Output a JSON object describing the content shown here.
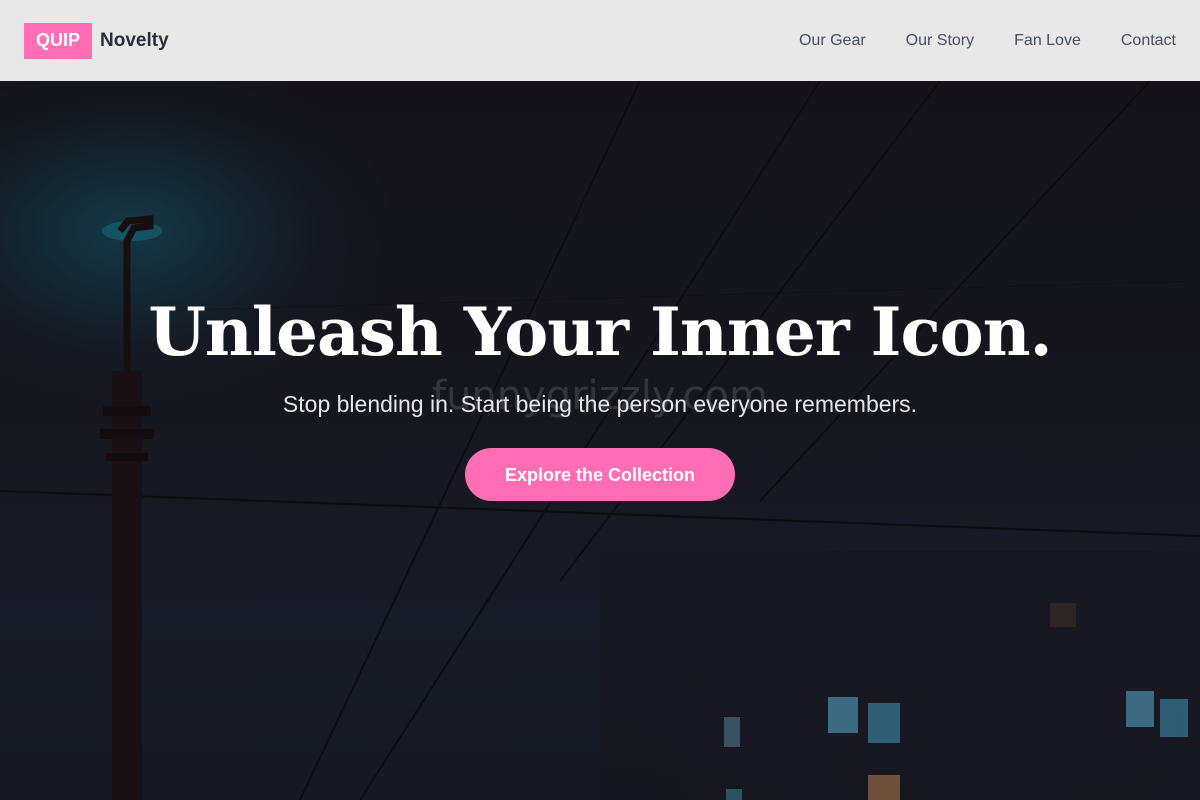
{
  "brand": {
    "badge": "QUIP",
    "name": "Novelty"
  },
  "nav": {
    "items": [
      {
        "label": "Our Gear"
      },
      {
        "label": "Our Story"
      },
      {
        "label": "Fan Love"
      },
      {
        "label": "Contact"
      }
    ]
  },
  "hero": {
    "title": "Unleash Your Inner Icon.",
    "subtitle": "Stop blending in. Start being the person everyone remembers.",
    "cta_label": "Explore the Collection",
    "watermark": "funnygrizzly.com"
  },
  "colors": {
    "accent": "#ff6eb4",
    "header_bg": "#e8e8e8",
    "hero_bg": "#18161d",
    "lamp_glow": "#1e9db5"
  }
}
